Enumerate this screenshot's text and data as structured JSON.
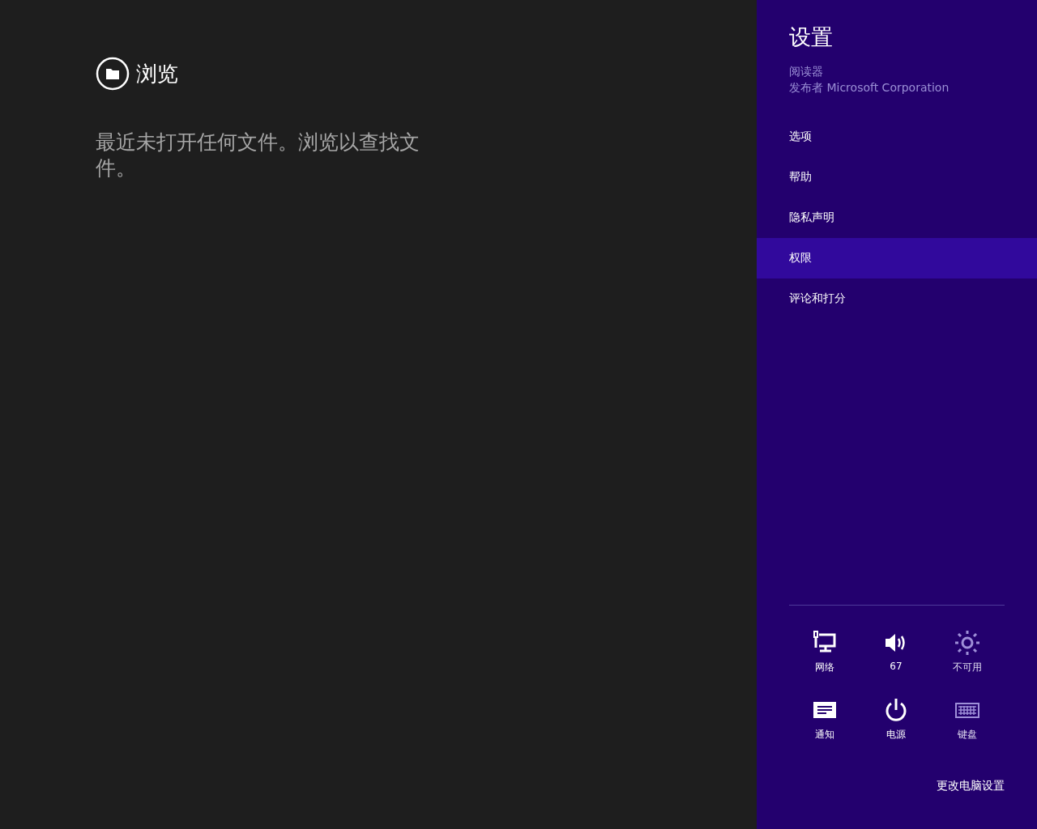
{
  "browse": {
    "label": "浏览",
    "message": "最近未打开任何文件。浏览以查找文件。"
  },
  "settings": {
    "title": "设置",
    "app_name": "阅读器",
    "publisher": "发布者 Microsoft Corporation",
    "items": [
      {
        "label": "选项",
        "selected": false
      },
      {
        "label": "帮助",
        "selected": false
      },
      {
        "label": "隐私声明",
        "selected": false
      },
      {
        "label": "权限",
        "selected": true
      },
      {
        "label": "评论和打分",
        "selected": false
      }
    ],
    "quick": [
      {
        "kind": "network",
        "label": "网络",
        "disabled": false
      },
      {
        "kind": "volume",
        "label": "67",
        "disabled": false
      },
      {
        "kind": "brightness",
        "label": "不可用",
        "disabled": true
      },
      {
        "kind": "notifications",
        "label": "通知",
        "disabled": false
      },
      {
        "kind": "power",
        "label": "电源",
        "disabled": false
      },
      {
        "kind": "keyboard",
        "label": "键盘",
        "disabled": true
      }
    ],
    "change_pc_settings": "更改电脑设置"
  }
}
